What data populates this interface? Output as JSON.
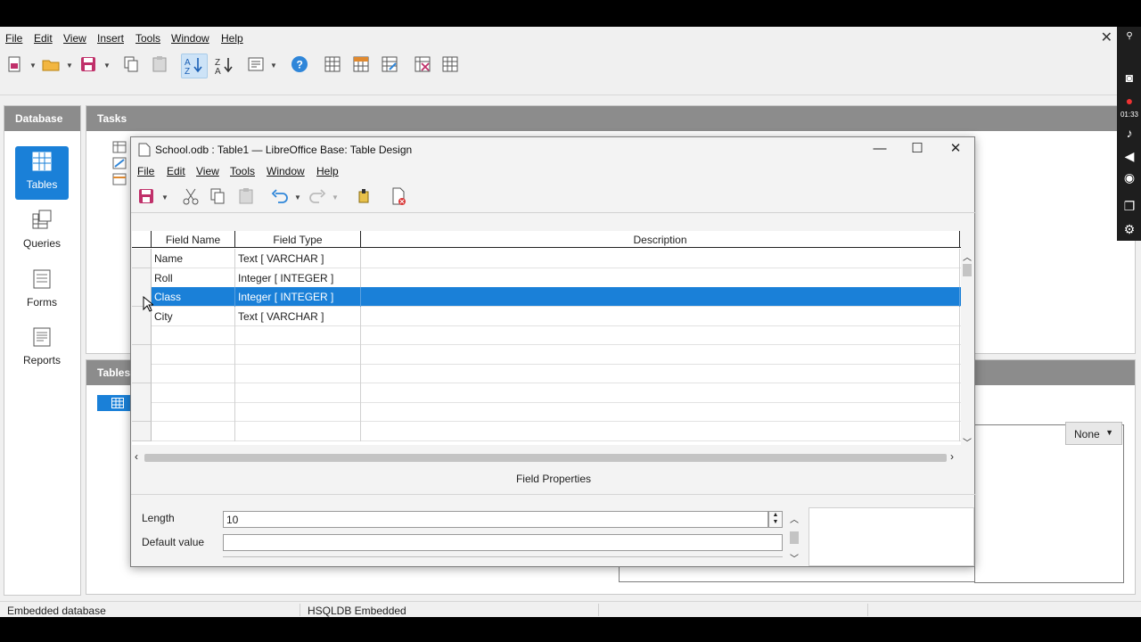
{
  "app_menu": {
    "file": "File",
    "edit": "Edit",
    "view": "View",
    "insert": "Insert",
    "tools": "Tools",
    "window": "Window",
    "help": "Help"
  },
  "database_panel": {
    "title": "Database",
    "items": [
      {
        "label": "Tables",
        "icon": "tables-icon",
        "selected": true
      },
      {
        "label": "Queries",
        "icon": "queries-icon",
        "selected": false
      },
      {
        "label": "Forms",
        "icon": "forms-icon",
        "selected": false
      },
      {
        "label": "Reports",
        "icon": "reports-icon",
        "selected": false
      }
    ]
  },
  "tasks_panel": {
    "title": "Tasks"
  },
  "tables_panel": {
    "title": "Tables",
    "preview_select": "None"
  },
  "recorder_strip": {
    "timer": "01:33"
  },
  "statusbar": {
    "left": "Embedded database",
    "middle": "HSQLDB Embedded"
  },
  "dialog": {
    "title": "School.odb : Table1 — LibreOffice Base: Table Design",
    "menu": {
      "file": "File",
      "edit": "Edit",
      "view": "View",
      "tools": "Tools",
      "window": "Window",
      "help": "Help"
    },
    "columns": {
      "field_name": "Field Name",
      "field_type": "Field Type",
      "description": "Description"
    },
    "rows": [
      {
        "name": "Name",
        "type": "Text [ VARCHAR ]",
        "description": ""
      },
      {
        "name": "Roll",
        "type": "Integer [ INTEGER ]",
        "description": ""
      },
      {
        "name": "Class",
        "type": "Integer [ INTEGER ]",
        "description": ""
      },
      {
        "name": "City",
        "type": "Text [ VARCHAR ]",
        "description": ""
      }
    ],
    "selected_row": 2,
    "field_properties": {
      "title": "Field Properties",
      "length_label": "Length",
      "length_value": "10",
      "default_label": "Default value",
      "default_value": ""
    }
  },
  "colors": {
    "accent": "#1a80d8",
    "panel_header": "#8c8c8c"
  }
}
